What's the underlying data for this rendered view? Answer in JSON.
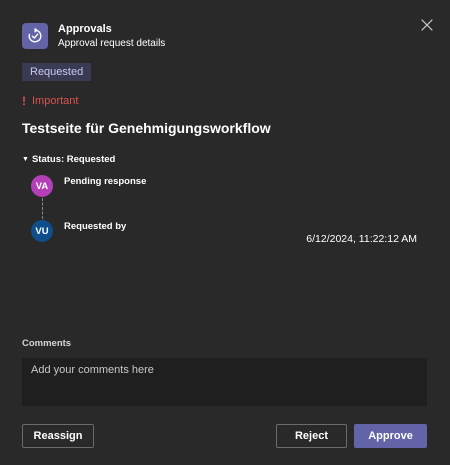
{
  "header": {
    "app_icon": "approvals-icon",
    "title": "Approvals",
    "subtitle": "Approval request details",
    "close_icon": "close-icon"
  },
  "request": {
    "status_badge": "Requested",
    "priority_icon": "exclamation-icon",
    "priority_label": "Important",
    "title": "Testseite für Genehmigungsworkflow"
  },
  "status": {
    "header": "Status: Requested",
    "timeline": [
      {
        "initials": "VA",
        "label": "Pending response",
        "color": "#b43fb8"
      },
      {
        "initials": "VU",
        "label": "Requested by",
        "color": "#0e4f8b"
      }
    ],
    "timestamp": "6/12/2024, 11:22:12 AM"
  },
  "comments": {
    "label": "Comments",
    "placeholder": "Add your comments here",
    "value": ""
  },
  "actions": {
    "reassign_label": "Reassign",
    "reject_label": "Reject",
    "approve_label": "Approve"
  },
  "colors": {
    "accent": "#6264a7",
    "important": "#d9524d",
    "badge_bg": "#3b3a53",
    "background": "#292929"
  }
}
